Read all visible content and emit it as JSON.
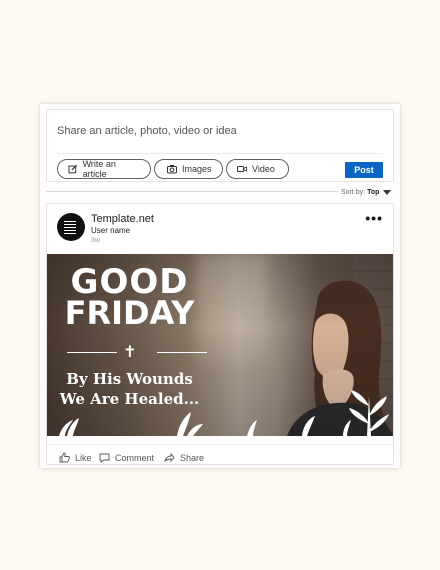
{
  "composer": {
    "prompt": "Share an article, photo, video or idea",
    "buttons": [
      {
        "label": "Write an article",
        "icon": "edit-icon"
      },
      {
        "label": "Images",
        "icon": "camera-icon"
      },
      {
        "label": "Video",
        "icon": "video-icon"
      }
    ],
    "post_label": "Post"
  },
  "feed": {
    "sort_prefix": "Sort by:",
    "sort_value": "Top"
  },
  "post": {
    "author": "Template.net",
    "subtitle": "User name",
    "time": "3w",
    "more": "•••",
    "image": {
      "line1": "GOOD",
      "line2": "FRIDAY",
      "cross": "✝",
      "tag1": "By His Wounds",
      "tag2": "We Are Healed..."
    },
    "actions": [
      {
        "label": "Like",
        "icon": "thumbs-up-icon"
      },
      {
        "label": "Comment",
        "icon": "comment-icon"
      },
      {
        "label": "Share",
        "icon": "share-icon"
      }
    ]
  },
  "colors": {
    "accent": "#0a66c2",
    "background": "#fdf8f1"
  }
}
